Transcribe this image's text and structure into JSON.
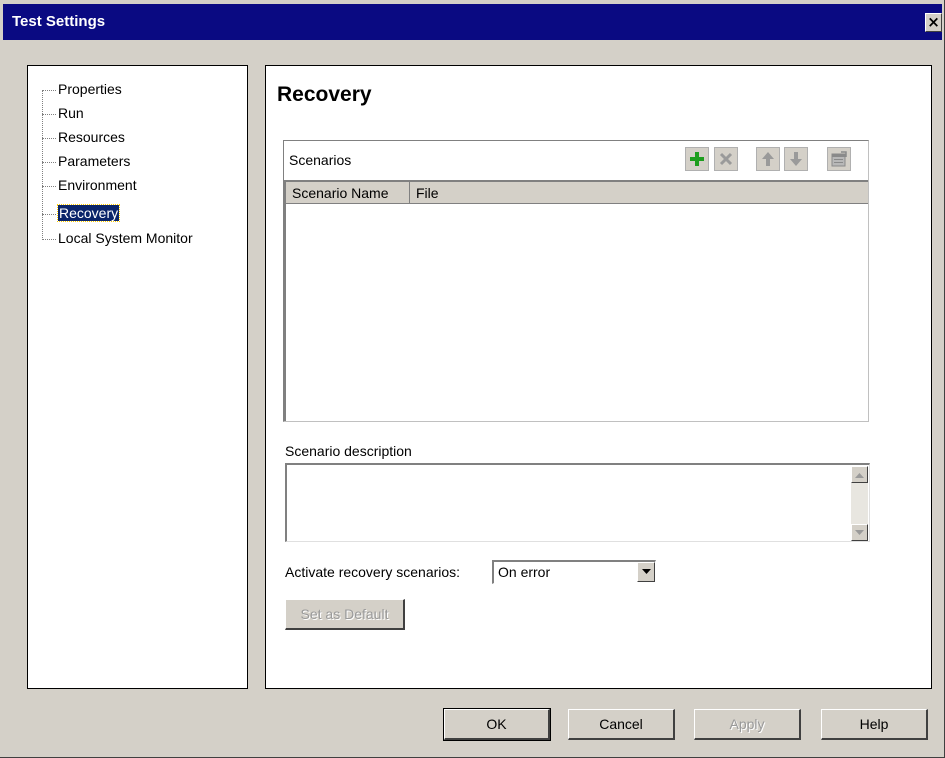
{
  "window": {
    "title": "Test Settings",
    "close_glyph": "×"
  },
  "tree": {
    "items": [
      {
        "label": "Properties"
      },
      {
        "label": "Run"
      },
      {
        "label": "Resources"
      },
      {
        "label": "Parameters"
      },
      {
        "label": "Environment"
      },
      {
        "label": "Recovery",
        "selected": true
      },
      {
        "label": "Local System Monitor"
      }
    ]
  },
  "main": {
    "heading": "Recovery",
    "scenarios": {
      "label": "Scenarios",
      "toolbar_icons": [
        "add-icon",
        "delete-icon",
        "move-up-icon",
        "move-down-icon",
        "properties-icon"
      ],
      "columns": [
        "Scenario Name",
        "File"
      ],
      "rows": []
    },
    "description": {
      "label": "Scenario description",
      "value": ""
    },
    "activate": {
      "label": "Activate recovery scenarios:",
      "value": "On error"
    },
    "set_default_button": "Set as Default"
  },
  "footer": {
    "ok": "OK",
    "cancel": "Cancel",
    "apply": "Apply",
    "help": "Help"
  },
  "colors": {
    "titlebar": "#0a0a82",
    "selection": "#0a246a",
    "add_icon": "#1e9e1e",
    "face": "#d4d0c8"
  }
}
